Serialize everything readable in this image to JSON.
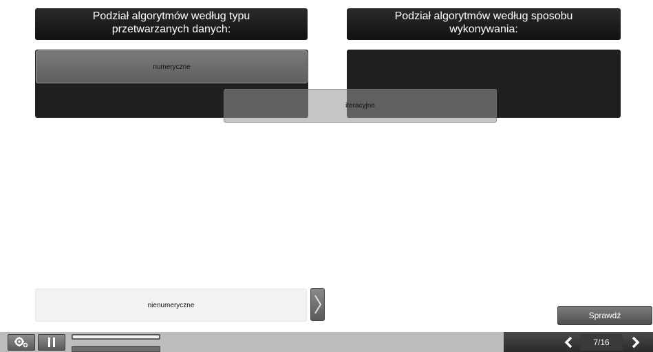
{
  "columns": [
    {
      "title": "Podział algorytmów według typu\nprzetwarzanych danych:",
      "placed": [
        "numeryczne"
      ]
    },
    {
      "title": "Podział algorytmów według sposobu\nwykonywania:",
      "placed": []
    }
  ],
  "dragging_tile": {
    "label": "iteracyjne"
  },
  "source_pool": {
    "tiles": [
      "nienumeryczne"
    ],
    "next_icon": "chevron-right-icon"
  },
  "check_button": {
    "label": "Sprawdź"
  },
  "bottom_bar": {
    "settings_icon": "gear-icon",
    "pause_icon": "pause-icon",
    "progress": 1.0,
    "pagination": {
      "current": 7,
      "total": 16,
      "text": "7/16"
    }
  },
  "colors": {
    "header_bg": "#111111",
    "zone_bg": "#1f1f1f",
    "bar_bg": "#bdbdbd"
  }
}
